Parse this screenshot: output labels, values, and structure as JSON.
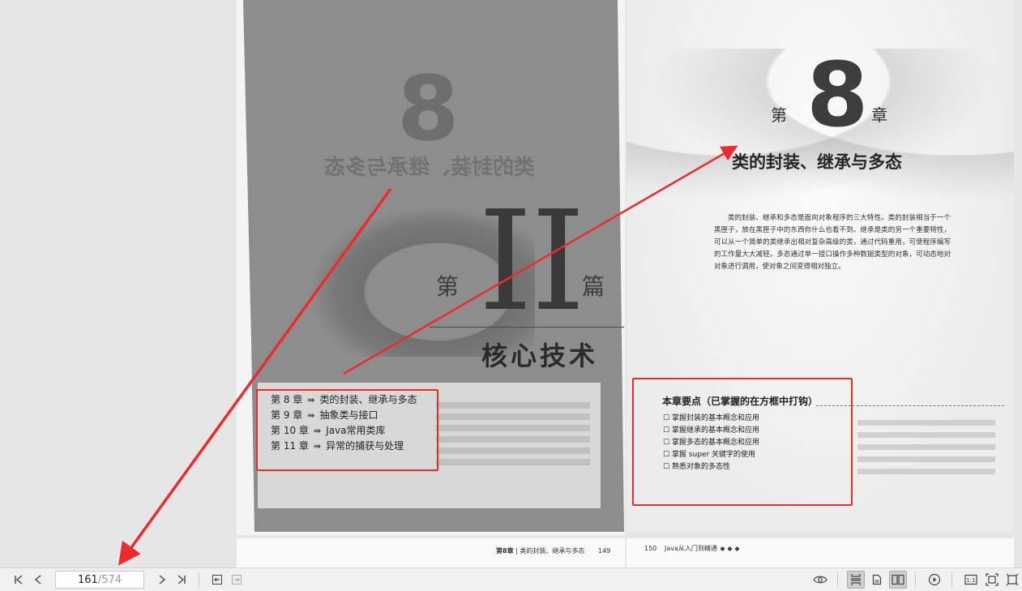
{
  "left_page": {
    "roman_numeral": "II",
    "part_left": "第",
    "part_right": "篇",
    "part_title": "核心技术",
    "ghost_title": "类的封装、继承与多态",
    "ghost_number": "8",
    "toc": [
      {
        "chapter": "第 8 章",
        "title": "类的封装、继承与多态"
      },
      {
        "chapter": "第 9 章",
        "title": "抽象类与接口"
      },
      {
        "chapter": "第 10 章",
        "title": "Java常用类库"
      },
      {
        "chapter": "第 11 章",
        "title": "异常的捕获与处理"
      }
    ],
    "toc_arrow": "⇛"
  },
  "right_page": {
    "chapter_prefix": "第",
    "chapter_number": "8",
    "chapter_suffix": "章",
    "chapter_title": "类的封装、继承与多态",
    "intro": "类的封装、继承和多态是面向对象程序的三大特性。类的封装相当于一个黑匣子，放在黑匣子中的东西你什么也看不到。继承是类的另一个重要特性，可以从一个简单的类继承出相对复杂高级的类，通过代码重用，可使程序编写的工作量大大减轻。多态通过单一接口操作多种数据类型的对象，可动态地对对象进行调用，使对象之间变得相对独立。",
    "key_points_title": "本章要点（已掌握的在方框中打钩）",
    "key_points": [
      "掌握封装的基本概念和应用",
      "掌握继承的基本概念和应用",
      "掌握多态的基本概念和应用",
      "掌握 super 关键字的使用",
      "熟悉对象的多态性"
    ]
  },
  "next_spread": {
    "left_running_head_chapter": "第8章",
    "left_running_head_title": "类的封装、继承与多态",
    "left_page_number": "149",
    "right_page_number": "150",
    "right_running_head": "Java从入门到精通"
  },
  "toolbar": {
    "current_page": "161",
    "total_pages": "/574",
    "icons": [
      "first-page-icon",
      "prev-page-icon",
      "next-page-icon",
      "last-page-icon",
      "back-icon",
      "forward-icon",
      "eye-icon",
      "continuous-page-icon",
      "single-page-icon",
      "two-page-icon",
      "play-icon",
      "actual-size-icon",
      "fit-page-icon",
      "fullscreen-icon"
    ]
  },
  "colors": {
    "annotation_red": "#ee2b2b",
    "toolbar_bg": "#f0f0f0",
    "scan_grey": "#8d8d8d"
  }
}
